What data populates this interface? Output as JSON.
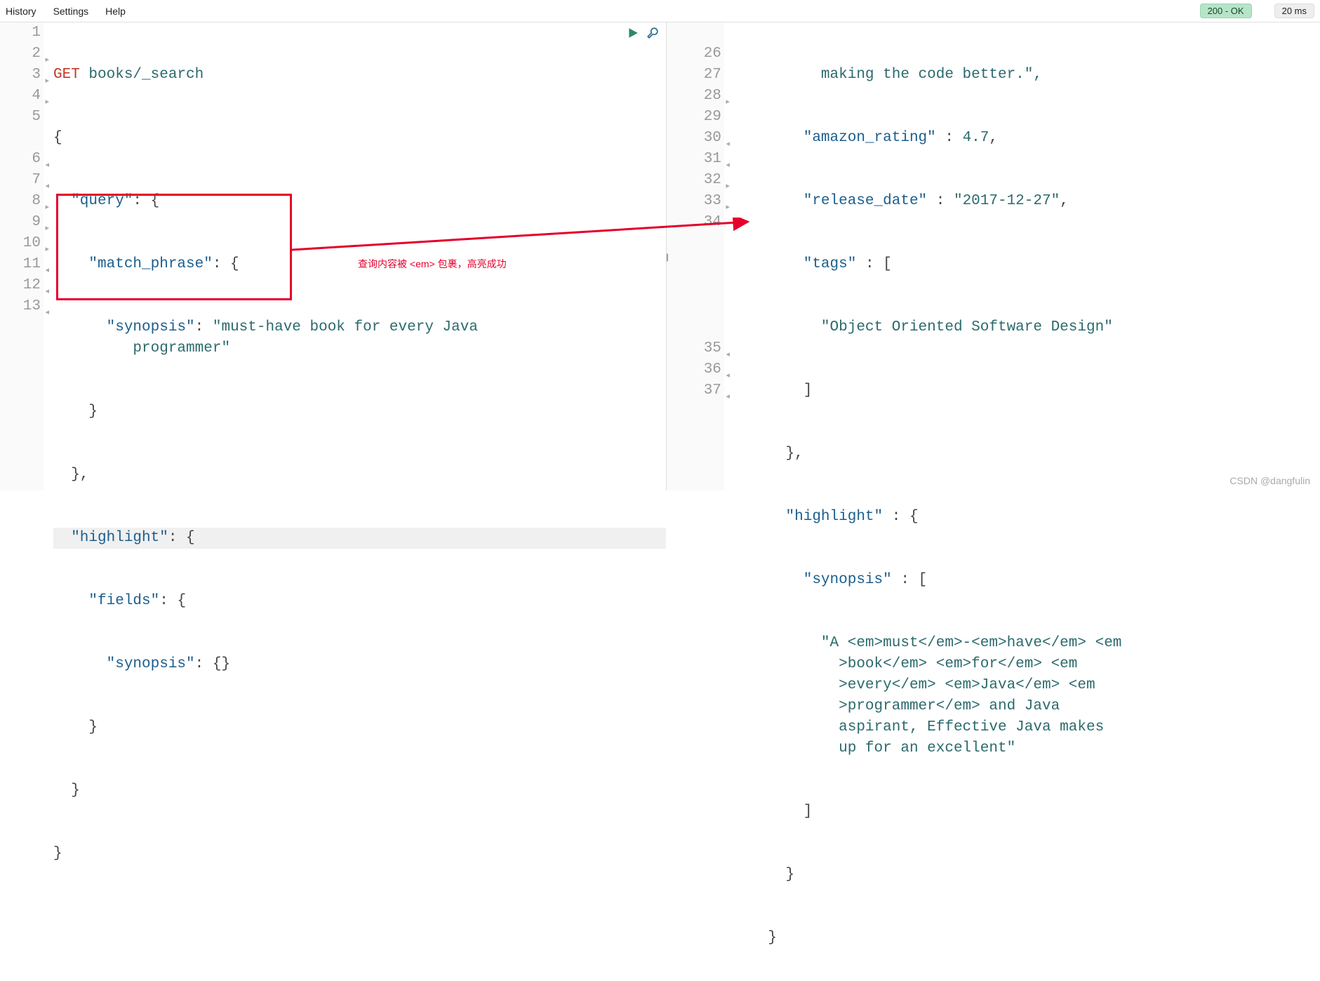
{
  "menu": {
    "history": "History",
    "settings": "Settings",
    "help": "Help"
  },
  "status": {
    "label": "200 - OK"
  },
  "time": {
    "label": "20 ms"
  },
  "left": {
    "gutter": [
      "1",
      "2",
      "3",
      "4",
      "5",
      "6",
      "7",
      "8",
      "9",
      "10",
      "11",
      "12",
      "13"
    ],
    "fold": [
      "",
      "▸",
      "▸",
      "▸",
      "",
      "◂",
      "◂",
      "▸",
      "▸",
      "▸",
      "◂",
      "◂",
      "◂"
    ],
    "method": "GET",
    "path": "books/_search",
    "l2": "{",
    "l3a": "  \"query\"",
    "l3b": ": {",
    "l4a": "    \"match_phrase\"",
    "l4b": ": {",
    "l5a": "      \"synopsis\"",
    "l5b": ": ",
    "l5c": "\"must-have book for every Java\n         programmer\"",
    "l6": "    }",
    "l7": "  },",
    "l8a": "  \"highlight\"",
    "l8b": ": {",
    "l9a": "    \"fields\"",
    "l9b": ": {",
    "l10a": "      \"synopsis\"",
    "l10b": ": {}",
    "l11": "    }",
    "l12": "  }",
    "l13": "}"
  },
  "right": {
    "gutter": [
      "",
      "26",
      "27",
      "28",
      "29",
      "30",
      "31",
      "32",
      "33",
      "34",
      "",
      "",
      "",
      "",
      "",
      "35",
      "36",
      "37"
    ],
    "fold": [
      "",
      "",
      "",
      "▸",
      "",
      "◂",
      "◂",
      "▸",
      "▸",
      "",
      "",
      "",
      "",
      "",
      "",
      "◂",
      "◂",
      "◂"
    ],
    "r0": "          making the code better.\",",
    "r26a": "        \"amazon_rating\"",
    "r26b": " : ",
    "r26c": "4.7",
    "r26d": ",",
    "r27a": "        \"release_date\"",
    "r27b": " : ",
    "r27c": "\"2017-12-27\"",
    "r27d": ",",
    "r28a": "        \"tags\"",
    "r28b": " : [",
    "r29": "          \"Object Oriented Software Design\"",
    "r30": "        ]",
    "r31": "      },",
    "r32a": "      \"highlight\"",
    "r32b": " : {",
    "r33a": "        \"synopsis\"",
    "r33b": " : [",
    "r34": "          \"A <em>must</em>-<em>have</em> <em\n            >book</em> <em>for</em> <em\n            >every</em> <em>Java</em> <em\n            >programmer</em> and Java\n            aspirant, Effective Java makes\n            up for an excellent\"",
    "r35": "        ]",
    "r36": "      }",
    "r37": "    }"
  },
  "annotation": "查询内容被 <em> 包裹，高亮成功",
  "watermark": "CSDN @dangfulin"
}
